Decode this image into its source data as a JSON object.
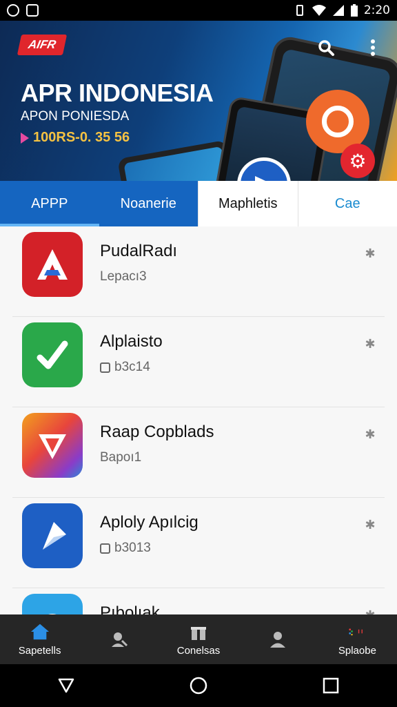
{
  "status_bar": {
    "time": "2:20"
  },
  "banner": {
    "brand": "AIFR",
    "title": "APR INDONESIA",
    "subtitle": "APON PONIESDA",
    "number": "100RS-0. 35 56"
  },
  "tabs": [
    {
      "label": "APPP"
    },
    {
      "label": "Noanerie"
    },
    {
      "label": "Maphletis"
    },
    {
      "label": "Cae"
    }
  ],
  "apps": [
    {
      "name": "PudalRadı",
      "sub": "Lepacı3",
      "icon": "a-logo-icon",
      "color": "#d32128"
    },
    {
      "name": "Alplaisto",
      "sub": "b3c14",
      "icon": "checkmark-icon",
      "color": "#2aa84a"
    },
    {
      "name": "Raap Copblads",
      "sub": "Bapoı1",
      "icon": "v-logo-icon",
      "color": "#e8453c"
    },
    {
      "name": "Aploly Apılcig",
      "sub": "b3013",
      "icon": "arrow-logo-icon",
      "color": "#1e5fc4"
    },
    {
      "name": "Pıbolıak",
      "sub": "",
      "icon": "play-logo-icon",
      "color": "#2da4e6"
    }
  ],
  "bottom_nav": [
    {
      "label": "Sapetells",
      "icon": "home-icon"
    },
    {
      "label": "",
      "icon": "search-person-icon"
    },
    {
      "label": "Conelsas",
      "icon": "gift-icon"
    },
    {
      "label": "",
      "icon": "person-icon"
    },
    {
      "label": "Splaobe",
      "icon": "dots-icon"
    }
  ]
}
